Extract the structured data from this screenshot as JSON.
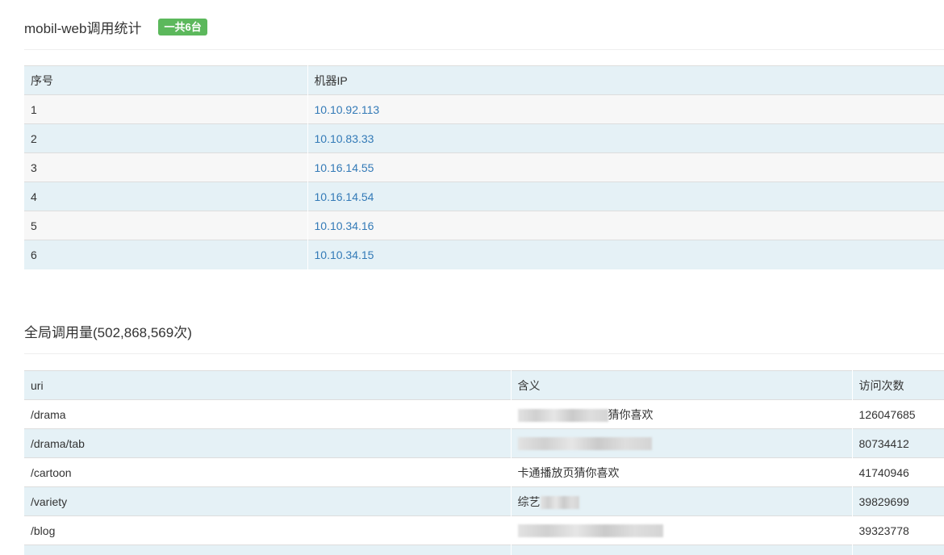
{
  "machine_section": {
    "title": "mobil-web调用统计",
    "badge": "一共6台",
    "columns": [
      "序号",
      "机器IP"
    ],
    "rows": [
      {
        "index": "1",
        "ip": "10.10.92.113"
      },
      {
        "index": "2",
        "ip": "10.10.83.33"
      },
      {
        "index": "3",
        "ip": "10.16.14.55"
      },
      {
        "index": "4",
        "ip": "10.16.14.54"
      },
      {
        "index": "5",
        "ip": "10.10.34.16"
      },
      {
        "index": "6",
        "ip": "10.10.34.15"
      }
    ]
  },
  "global_section": {
    "title": "全局调用量(502,868,569次)",
    "columns": [
      "uri",
      "含义",
      "访问次数"
    ],
    "rows": [
      {
        "uri": "/drama",
        "meaning": "猜你喜欢",
        "count": "126047685"
      },
      {
        "uri": "/drama/tab",
        "meaning": "",
        "count": "80734412"
      },
      {
        "uri": "/cartoon",
        "meaning": "卡通播放页猜你喜欢",
        "count": "41740946"
      },
      {
        "uri": "/variety",
        "meaning": "综艺",
        "count": "39829699"
      },
      {
        "uri": "/blog",
        "meaning": "",
        "count": "39323778"
      }
    ]
  }
}
